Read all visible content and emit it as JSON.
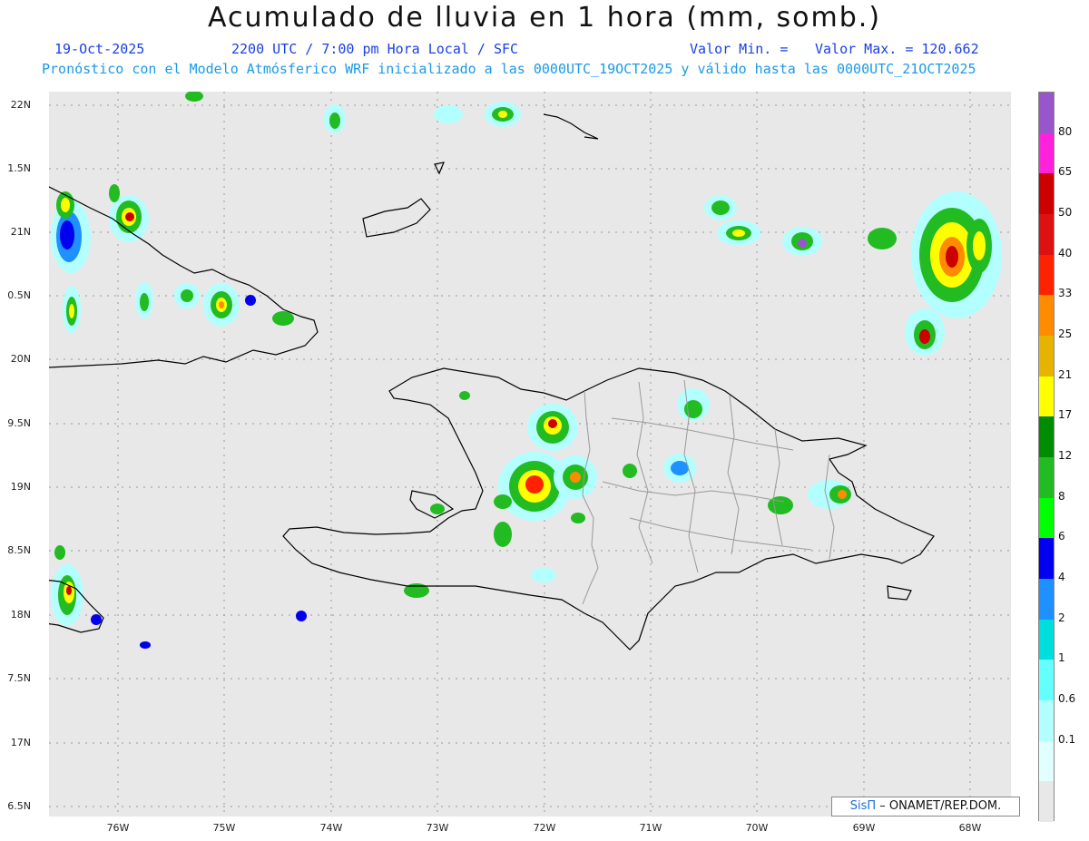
{
  "header": {
    "title": "Acumulado de lluvia en 1 hora (mm, somb.)",
    "date": "19-Oct-2025",
    "time_info": "2200 UTC / 7:00 pm Hora Local / SFC",
    "valor_min": "Valor Min. =",
    "valor_max": "Valor Max. = 120.662",
    "model_info": "Pronóstico con el Modelo Atmósferico WRF inicializado a las 0000UTC_19OCT2025 y válido hasta las  0000UTC_21OCT2025"
  },
  "axes": {
    "lat_labels": [
      "22N",
      "1.5N",
      "21N",
      "0.5N",
      "20N",
      "9.5N",
      "19N",
      "8.5N",
      "18N",
      "7.5N",
      "17N",
      "6.5N"
    ],
    "lon_labels": [
      "76W",
      "75W",
      "74W",
      "73W",
      "72W",
      "71W",
      "70W",
      "69W",
      "68W"
    ]
  },
  "colorbar": {
    "labels": [
      "80",
      "65",
      "50",
      "40",
      "33",
      "25",
      "21",
      "17",
      "12",
      "8",
      "6",
      "4",
      "2",
      "1",
      "0.6",
      "0.1"
    ],
    "colors": [
      "#9955cc",
      "#ff22dd",
      "#cc0000",
      "#dd1111",
      "#ff2200",
      "#ff8c00",
      "#e6b400",
      "#ffff00",
      "#008c00",
      "#22bb22",
      "#00ff00",
      "#0000ee",
      "#1e90ff",
      "#00dddd",
      "#66ffff",
      "#b3ffff",
      "#e0ffff",
      "#e8e8e8"
    ]
  },
  "credit": {
    "brand": "SisΠ",
    "text": "– ONAMET/REP.DOM."
  },
  "map": {
    "background": "#e8e8e8",
    "coast_color": "#000000",
    "border_color": "#999999"
  }
}
